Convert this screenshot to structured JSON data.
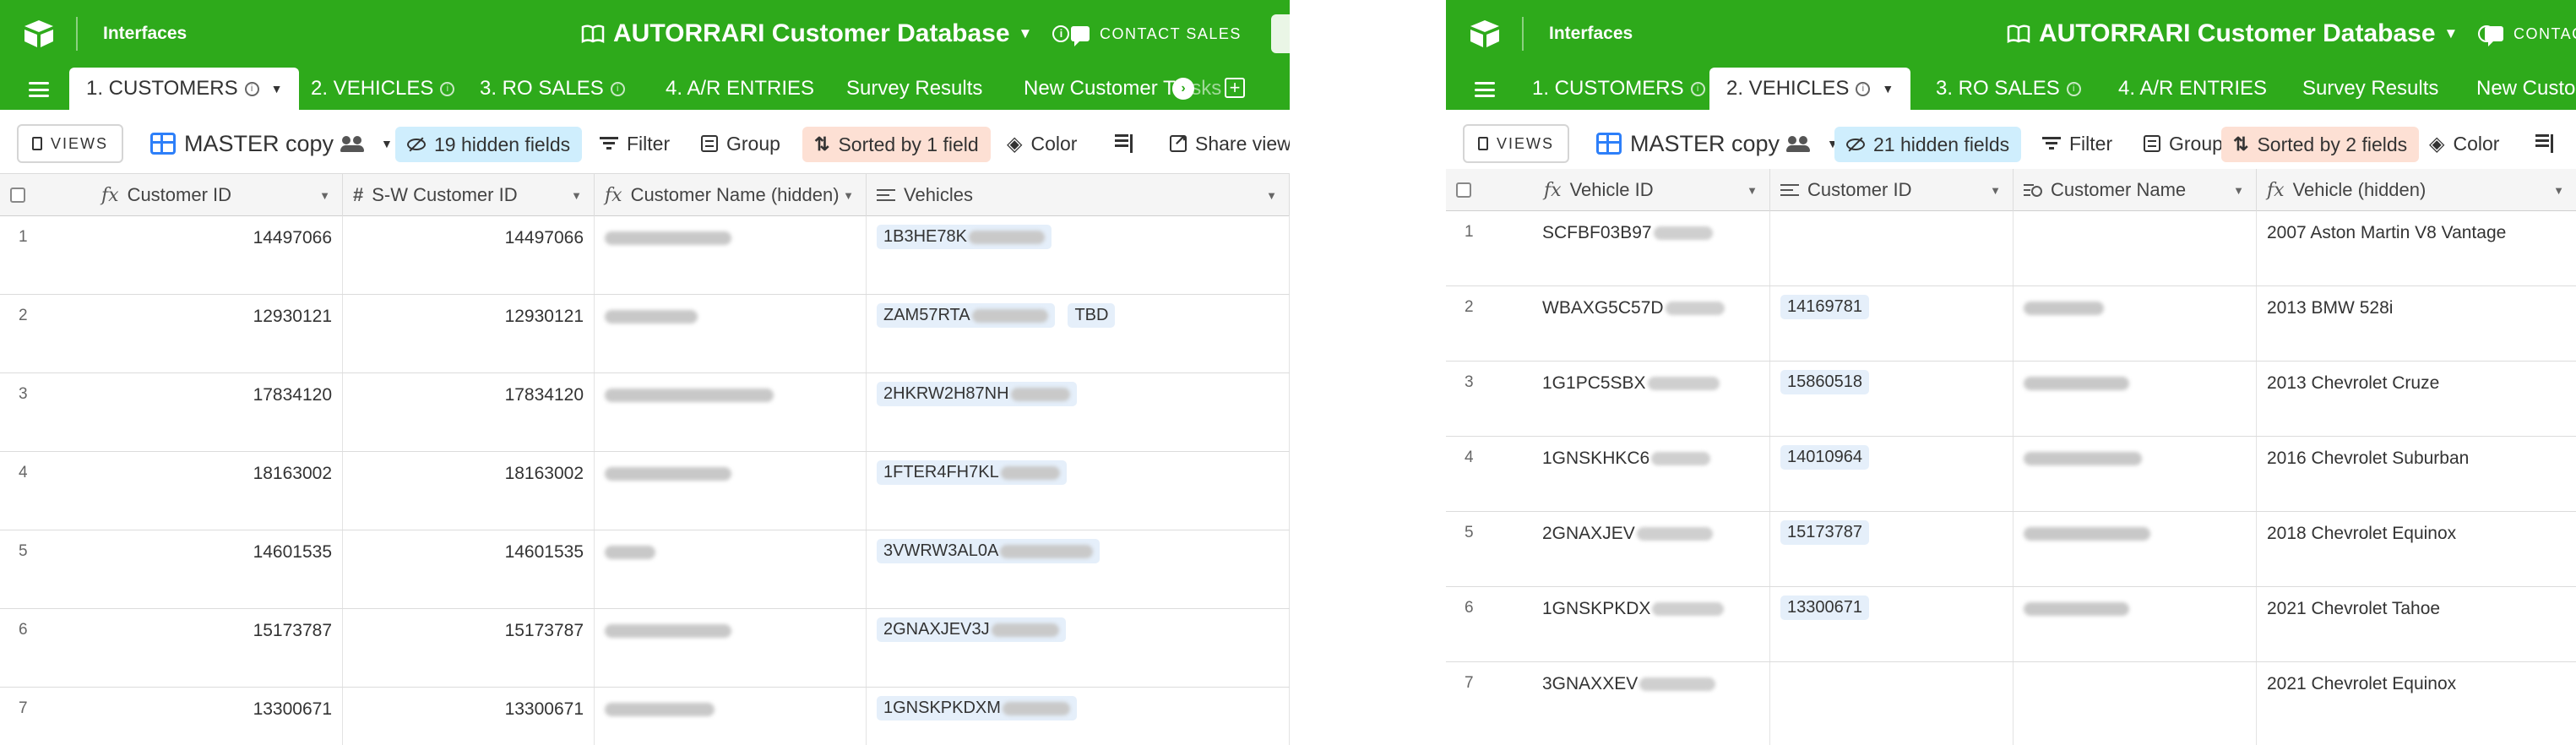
{
  "left": {
    "app": {
      "section": "Interfaces",
      "base_title": "AUTORRARI Customer Database",
      "contact_sales": "CONTACT SALES"
    },
    "tabs": [
      {
        "label": "1. CUSTOMERS",
        "active": true
      },
      {
        "label": "2. VEHICLES",
        "active": false
      },
      {
        "label": "3. RO SALES",
        "active": false
      },
      {
        "label": "4. A/R ENTRIES",
        "active": false
      },
      {
        "label": "Survey Results",
        "active": false
      },
      {
        "label": "New Customer Ta",
        "faded": "sks",
        "active": false
      }
    ],
    "toolbar": {
      "views_label": "VIEWS",
      "view_name": "MASTER copy",
      "hidden_fields": "19 hidden fields",
      "filter": "Filter",
      "group": "Group",
      "sorted": "Sorted by 1 field",
      "color": "Color",
      "share": "Share view"
    },
    "columns": [
      {
        "label": "Customer ID",
        "icon": "formula-icon"
      },
      {
        "label": "S-W Customer ID",
        "icon": "number-icon"
      },
      {
        "label": "Customer Name (hidden)",
        "icon": "formula-icon"
      },
      {
        "label": "Vehicles",
        "icon": "link-icon"
      }
    ],
    "rows": [
      {
        "n": "1",
        "customer_id": "14497066",
        "sw_id": "14497066",
        "vehicle": "1B3HE78K",
        "extra": ""
      },
      {
        "n": "2",
        "customer_id": "12930121",
        "sw_id": "12930121",
        "vehicle": "ZAM57RTA",
        "extra": "TBD"
      },
      {
        "n": "3",
        "customer_id": "17834120",
        "sw_id": "17834120",
        "vehicle": "2HKRW2H87NH",
        "extra": ""
      },
      {
        "n": "4",
        "customer_id": "18163002",
        "sw_id": "18163002",
        "vehicle": "1FTER4FH7KL",
        "extra": ""
      },
      {
        "n": "5",
        "customer_id": "14601535",
        "sw_id": "14601535",
        "vehicle": "3VWRW3AL0A",
        "extra": ""
      },
      {
        "n": "6",
        "customer_id": "15173787",
        "sw_id": "15173787",
        "vehicle": "2GNAXJEV3J",
        "extra": ""
      },
      {
        "n": "7",
        "customer_id": "13300671",
        "sw_id": "13300671",
        "vehicle": "1GNSKPKDXM",
        "extra": ""
      }
    ]
  },
  "right": {
    "app": {
      "section": "Interfaces",
      "base_title": "AUTORRARI Customer Database",
      "contact_sales": "CONTAC"
    },
    "tabs": [
      {
        "label": "1. CUSTOMERS",
        "active": false
      },
      {
        "label": "2. VEHICLES",
        "active": true
      },
      {
        "label": "3. RO SALES",
        "active": false
      },
      {
        "label": "4. A/R ENTRIES",
        "active": false
      },
      {
        "label": "Survey Results",
        "active": false
      },
      {
        "label": "New Customer T",
        "active": false
      }
    ],
    "toolbar": {
      "views_label": "VIEWS",
      "view_name": "MASTER copy",
      "hidden_fields": "21 hidden fields",
      "filter": "Filter",
      "group": "Group",
      "sorted": "Sorted by 2 fields",
      "color": "Color"
    },
    "columns": [
      {
        "label": "Vehicle ID",
        "icon": "formula-icon"
      },
      {
        "label": "Customer ID",
        "icon": "link-icon"
      },
      {
        "label": "Customer Name",
        "icon": "lookup-icon"
      },
      {
        "label": "Vehicle (hidden)",
        "icon": "formula-icon"
      }
    ],
    "rows": [
      {
        "n": "1",
        "vehicle_id": "SCFBF03B97",
        "customer_id": "",
        "vehicle_hidden": "2007 Aston Martin V8 Vantage"
      },
      {
        "n": "2",
        "vehicle_id": "WBAXG5C57D",
        "customer_id": "14169781",
        "vehicle_hidden": "2013 BMW 528i"
      },
      {
        "n": "3",
        "vehicle_id": "1G1PC5SBX",
        "customer_id": "15860518",
        "vehicle_hidden": "2013 Chevrolet Cruze"
      },
      {
        "n": "4",
        "vehicle_id": "1GNSKHKC6",
        "customer_id": "14010964",
        "vehicle_hidden": "2016 Chevrolet Suburban"
      },
      {
        "n": "5",
        "vehicle_id": "2GNAXJEV",
        "customer_id": "15173787",
        "vehicle_hidden": "2018 Chevrolet Equinox"
      },
      {
        "n": "6",
        "vehicle_id": "1GNSKPKDX",
        "customer_id": "13300671",
        "vehicle_hidden": "2021 Chevrolet Tahoe"
      },
      {
        "n": "7",
        "vehicle_id": "3GNAXXEV",
        "customer_id": "",
        "vehicle_hidden": "2021 Chevrolet Equinox"
      }
    ]
  },
  "colors": {
    "brand_green": "#2eaa1b",
    "hidden_pill": "#cfeefd",
    "sorted_pill": "#fde0d4",
    "chip": "#e5effa",
    "accent_blue": "#2d7ff9"
  }
}
